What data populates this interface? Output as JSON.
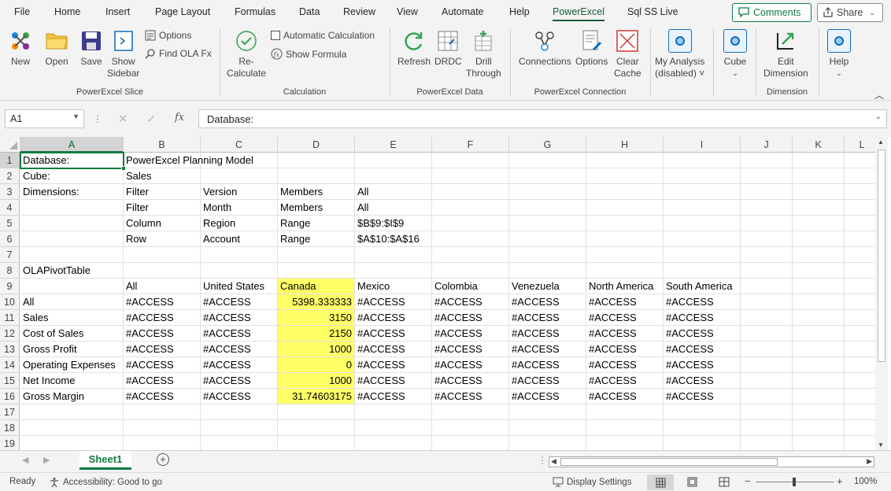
{
  "menu": {
    "tabs": [
      "File",
      "Home",
      "Insert",
      "Page Layout",
      "Formulas",
      "Data",
      "Review",
      "View",
      "Automate",
      "Help",
      "PowerExcel",
      "Sql SS Live"
    ],
    "active_tab": "PowerExcel",
    "comments_label": "Comments",
    "share_label": "Share"
  },
  "ribbon": {
    "slice": {
      "new": "New",
      "open": "Open",
      "save": "Save",
      "show_sidebar_1": "Show",
      "show_sidebar_2": "Sidebar",
      "options": "Options",
      "find_ola": "Find OLA Fx",
      "label": "PowerExcel Slice"
    },
    "calculation": {
      "recalc_1": "Re-",
      "recalc_2": "Calculate",
      "auto_calc": "Automatic Calculation",
      "show_formula": "Show Formula",
      "label": "Calculation"
    },
    "data": {
      "refresh": "Refresh",
      "drdc": "DRDC",
      "drill_1": "Drill",
      "drill_2": "Through",
      "label": "PowerExcel Data"
    },
    "connection": {
      "connections": "Connections",
      "options": "Options",
      "clear_1": "Clear",
      "clear_2": "Cache",
      "label": "PowerExcel Connection"
    },
    "analysis": {
      "line1": "My Analysis",
      "line2": "(disabled) ˅"
    },
    "cube": {
      "label": "Cube"
    },
    "dimension": {
      "edit_1": "Edit",
      "edit_2": "Dimension",
      "label": "Dimension"
    },
    "help": {
      "label": "Help"
    }
  },
  "formula_bar": {
    "name_box": "A1",
    "formula": "Database:"
  },
  "columns": [
    "A",
    "B",
    "C",
    "D",
    "E",
    "F",
    "G",
    "H",
    "I",
    "J",
    "K",
    "L"
  ],
  "rows": [
    1,
    2,
    3,
    4,
    5,
    6,
    7,
    8,
    9,
    10,
    11,
    12,
    13,
    14,
    15,
    16,
    17,
    18,
    19
  ],
  "cells": {
    "r1": [
      "Database:",
      "PowerExcel Planning Model",
      "",
      "",
      "",
      "",
      "",
      "",
      ""
    ],
    "r2": [
      "Cube:",
      "Sales",
      "",
      "",
      "",
      "",
      "",
      "",
      ""
    ],
    "r3": [
      "Dimensions:",
      "Filter",
      "Version",
      "Members",
      "All",
      "",
      "",
      "",
      ""
    ],
    "r4": [
      "",
      "Filter",
      "Month",
      "Members",
      "All",
      "",
      "",
      "",
      ""
    ],
    "r5": [
      "",
      "Column",
      "Region",
      "Range",
      "$B$9:$I$9",
      "",
      "",
      "",
      ""
    ],
    "r6": [
      "",
      "Row",
      "Account",
      "Range",
      "$A$10:$A$16",
      "",
      "",
      "",
      ""
    ],
    "r8": [
      "OLAPivotTable",
      "",
      "",
      "",
      "",
      "",
      "",
      "",
      ""
    ],
    "r9": [
      "",
      "All",
      "United States",
      "Canada",
      "Mexico",
      "Colombia",
      "Venezuela",
      "North America",
      "South America"
    ],
    "r10": [
      "All",
      "#ACCESS",
      "#ACCESS",
      "5398.333333",
      "#ACCESS",
      "#ACCESS",
      "#ACCESS",
      "#ACCESS",
      "#ACCESS"
    ],
    "r11": [
      "Sales",
      "#ACCESS",
      "#ACCESS",
      "3150",
      "#ACCESS",
      "#ACCESS",
      "#ACCESS",
      "#ACCESS",
      "#ACCESS"
    ],
    "r12": [
      "Cost of Sales",
      "#ACCESS",
      "#ACCESS",
      "2150",
      "#ACCESS",
      "#ACCESS",
      "#ACCESS",
      "#ACCESS",
      "#ACCESS"
    ],
    "r13": [
      "Gross Profit",
      "#ACCESS",
      "#ACCESS",
      "1000",
      "#ACCESS",
      "#ACCESS",
      "#ACCESS",
      "#ACCESS",
      "#ACCESS"
    ],
    "r14": [
      "Operating Expenses",
      "#ACCESS",
      "#ACCESS",
      "0",
      "#ACCESS",
      "#ACCESS",
      "#ACCESS",
      "#ACCESS",
      "#ACCESS"
    ],
    "r15": [
      "Net Income",
      "#ACCESS",
      "#ACCESS",
      "1000",
      "#ACCESS",
      "#ACCESS",
      "#ACCESS",
      "#ACCESS",
      "#ACCESS"
    ],
    "r16": [
      "Gross Margin",
      "#ACCESS",
      "#ACCESS",
      "31.74603175",
      "#ACCESS",
      "#ACCESS",
      "#ACCESS",
      "#ACCESS",
      "#ACCESS"
    ]
  },
  "highlight_color": "#ffff66",
  "sheet_tabs": [
    "Sheet1"
  ],
  "status": {
    "ready": "Ready",
    "accessibility": "Accessibility: Good to go",
    "display_settings": "Display Settings",
    "zoom": "100%"
  }
}
